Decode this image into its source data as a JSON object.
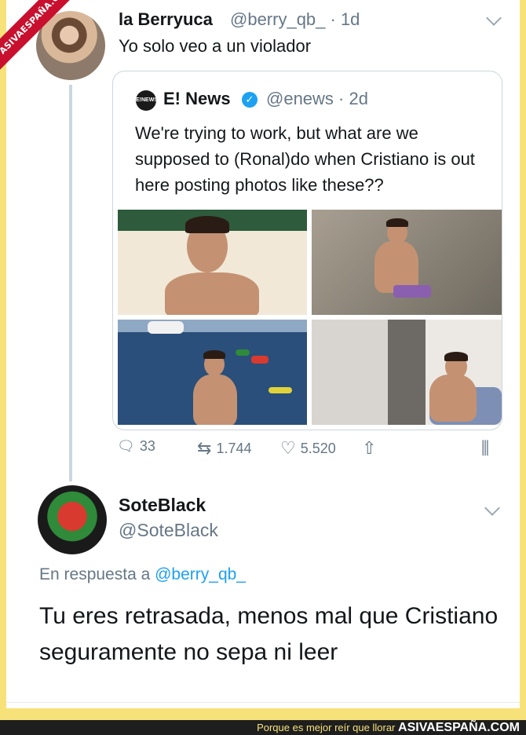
{
  "watermark": {
    "ribbon_text": "ASIVAESPAÑA.COM"
  },
  "tweet1": {
    "name": "la Berryuca",
    "handle_time": "@berry_qb_ · 1d",
    "text": "Yo solo veo a un violador"
  },
  "quoted": {
    "logo": "E!NEWS",
    "name": "E! News",
    "verified_icon": "✓",
    "handle_time": "@enews · 2d",
    "text": "We're trying to work, but what are we supposed to (Ronal)do when Cristiano is out here posting photos like these??",
    "photos": [
      "photo-1",
      "photo-2",
      "photo-3",
      "photo-4"
    ]
  },
  "actions": {
    "reply_icon": "🗨",
    "reply_count": "33",
    "retweet_icon": "⇆",
    "retweet_count": "1.744",
    "like_icon": "♡",
    "like_count": "5.520",
    "share_icon": "⇧",
    "stats_icon": "⫼"
  },
  "tweet2": {
    "name": "SoteBlack",
    "handle": "@SoteBlack",
    "reply_prefix": "En respuesta a",
    "reply_to": "@berry_qb_",
    "text": "Tu eres retrasada, menos mal que Cristiano seguramente no sepa ni leer"
  },
  "footer": {
    "tagline": "Porque es mejor reír que llorar",
    "brand": "ASIVAESPAÑA.COM"
  },
  "colors": {
    "link": "#1da1f2",
    "muted": "#657786",
    "frame": "#f7e27a",
    "ribbon": "#c8102e"
  }
}
